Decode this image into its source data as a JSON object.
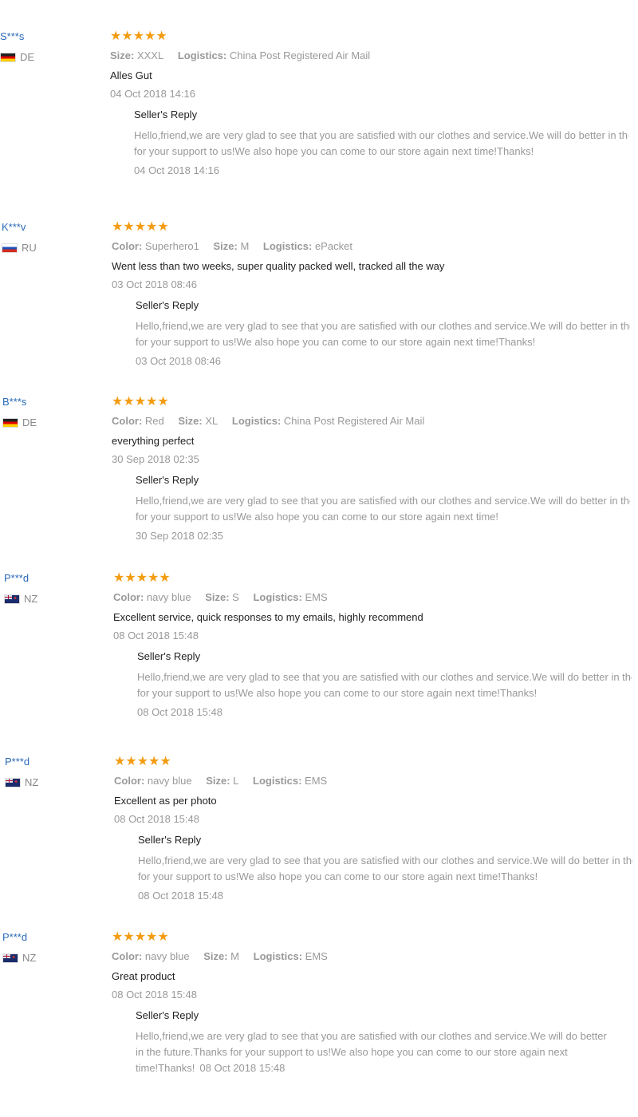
{
  "colors": {
    "name": "#2a6ab8",
    "star": "#f39c12",
    "muted": "#999999",
    "text": "#222222"
  },
  "icons": {
    "star": "star-icon",
    "flag": "flag-icon"
  },
  "reviews": [
    {
      "name": "S***s",
      "country": "DE",
      "flag": "de",
      "stars": "★★★★★",
      "attrs": [
        {
          "k": "Size:",
          "v": "XXXL"
        },
        {
          "k": "Logistics:",
          "v": "China Post Registered Air Mail"
        }
      ],
      "text": "Alles Gut",
      "date": "04 Oct 2018 14:16",
      "reply_title": "Seller's Reply",
      "reply_lines": [
        "Hello,friend,we are very glad to see that you are satisfied with our clothes and service.We will do better in the future.Thanks",
        "for your support to us!We also hope you can come to our store again next time!Thanks!"
      ],
      "reply_date": "04 Oct 2018 14:16"
    },
    {
      "name": "K***v",
      "country": "RU",
      "flag": "ru",
      "stars": "★★★★★",
      "attrs": [
        {
          "k": "Color:",
          "v": "Superhero1"
        },
        {
          "k": "Size:",
          "v": "M"
        },
        {
          "k": "Logistics:",
          "v": "ePacket"
        }
      ],
      "text": "Went less than two weeks, super quality packed well, tracked all the way",
      "date": "03 Oct 2018 08:46",
      "reply_title": "Seller's Reply",
      "reply_lines": [
        "Hello,friend,we are very glad to see that you are satisfied with our clothes and service.We will do better in the future.Thanks",
        "for your support to us!We also hope you can come to our store again next time!Thanks!"
      ],
      "reply_date": "03 Oct 2018 08:46"
    },
    {
      "name": "B***s",
      "country": "DE",
      "flag": "de",
      "stars": "★★★★★",
      "attrs": [
        {
          "k": "Color:",
          "v": "Red"
        },
        {
          "k": "Size:",
          "v": "XL"
        },
        {
          "k": "Logistics:",
          "v": "China Post Registered Air Mail"
        }
      ],
      "text": "everything perfect",
      "date": "30 Sep 2018 02:35",
      "reply_title": "Seller's Reply",
      "reply_lines": [
        "Hello,friend,we are very glad to see that you are satisfied with our clothes and service.We will do better in the future.Thanks",
        "for your support to us!We also hope you can come to our store again next time!"
      ],
      "reply_date": "30 Sep 2018 02:35"
    },
    {
      "name": "P***d",
      "country": "NZ",
      "flag": "nz",
      "stars": "★★★★★",
      "attrs": [
        {
          "k": "Color:",
          "v": "navy blue"
        },
        {
          "k": "Size:",
          "v": "S"
        },
        {
          "k": "Logistics:",
          "v": "EMS"
        }
      ],
      "text": "Excellent service, quick responses to my emails, highly recommend",
      "date": "08 Oct 2018 15:48",
      "reply_title": "Seller's Reply",
      "reply_lines": [
        "Hello,friend,we are very glad to see that you are satisfied with our clothes and service.We will do better in the future.Thanks",
        "for your support to us!We also hope you can come to our store again next time!Thanks!"
      ],
      "reply_date": "08 Oct 2018 15:48"
    },
    {
      "name": "P***d",
      "country": "NZ",
      "flag": "nz",
      "stars": "★★★★★",
      "attrs": [
        {
          "k": "Color:",
          "v": "navy blue"
        },
        {
          "k": "Size:",
          "v": "L"
        },
        {
          "k": "Logistics:",
          "v": "EMS"
        }
      ],
      "text": "Excellent as per photo",
      "date": "08 Oct 2018 15:48",
      "reply_title": "Seller's Reply",
      "reply_lines": [
        "Hello,friend,we are very glad to see that you are satisfied with our clothes and service.We will do better in the future.Thanks",
        "for your support to us!We also hope you can come to our store again next time!Thanks!"
      ],
      "reply_date": "08 Oct 2018 15:48"
    },
    {
      "name": "P***d",
      "country": "NZ",
      "flag": "nz",
      "stars": "★★★★★",
      "attrs": [
        {
          "k": "Color:",
          "v": "navy blue"
        },
        {
          "k": "Size:",
          "v": "M"
        },
        {
          "k": "Logistics:",
          "v": "EMS"
        }
      ],
      "text": "Great product",
      "date": "08 Oct 2018 15:48",
      "reply_title": "Seller's Reply",
      "reply_lines": [
        "Hello,friend,we are very glad to see that you are satisfied with our clothes and service.We will do better",
        "in the future.Thanks for your support to us!We also hope you can come to our store again next",
        "time!Thanks!"
      ],
      "reply_date": "08 Oct 2018 15:48"
    }
  ]
}
